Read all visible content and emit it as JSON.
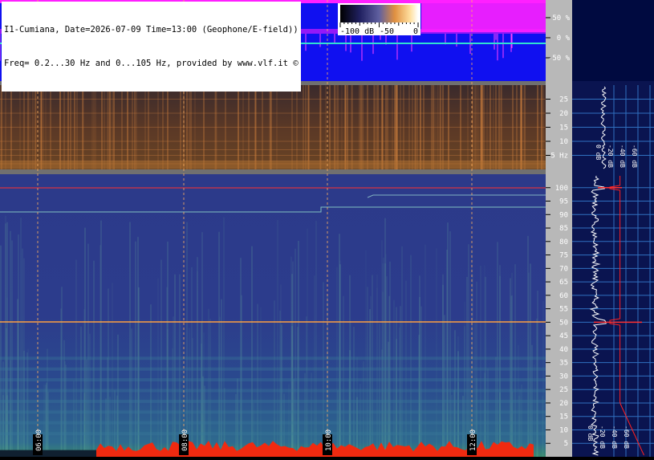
{
  "header": {
    "line1": "I1-Cumiana, Date=2026-07-09 Time=13:00 (Geophone/E-field))",
    "line2": "Freq= 0.2...30 Hz and 0...105 Hz, provided by www.vlf.it ©"
  },
  "colorbar": {
    "labels": [
      "-100 dB",
      "-50",
      "0"
    ]
  },
  "amplitude_panel": {
    "tick_labels": [
      "50 %",
      "0 %",
      "-50 %"
    ]
  },
  "low_freq_panel": {
    "tick_labels": [
      "25",
      "20",
      "15",
      "10",
      "5 Hz"
    ],
    "spectrum_ticks": [
      "0 dB",
      "-20 dB",
      "-40 dB",
      "-60 dB"
    ]
  },
  "high_freq_panel": {
    "tick_labels": [
      "100",
      "95",
      "90",
      "85",
      "80",
      "75",
      "70",
      "65",
      "60",
      "55",
      "50",
      "45",
      "40",
      "35",
      "30",
      "25",
      "20",
      "15",
      "10",
      "5"
    ],
    "spectrum_ticks": [
      "0 dB",
      "-20 dB",
      "-40 dB",
      "-60 dB"
    ]
  },
  "time_labels": [
    "06:00",
    "08:00",
    "10:00",
    "12:00"
  ],
  "colors": {
    "amplitude_bg": "#1010f0",
    "amplitude_trace": "#ff20ff",
    "zero_trace": "#30e0d0",
    "spectrogram_low": "#4a2a20",
    "spectrogram_high": "#2a3580",
    "grid_line": "#ffb060",
    "mains_line": "#ff3030",
    "axis_panel": "#b8b8b8",
    "right_panel": "#0a1450"
  },
  "chart_data": [
    {
      "type": "heatmap",
      "title": "I1-Cumiana, Date=2026-07-09 Time=13:00 (Geophone/E-field))",
      "ylabel": "Hz",
      "x_tick_labels": [
        "06:00",
        "08:00",
        "10:00",
        "12:00"
      ],
      "ylim": [
        0,
        30
      ],
      "y_ticks": [
        5,
        10,
        15,
        20,
        25
      ],
      "colorbar": {
        "min": -100,
        "max": 0,
        "unit": "dB",
        "ticks": [
          -100,
          -50,
          0
        ]
      }
    },
    {
      "type": "heatmap",
      "ylim": [
        0,
        105
      ],
      "y_ticks": [
        5,
        10,
        15,
        20,
        25,
        30,
        35,
        40,
        45,
        50,
        55,
        60,
        65,
        70,
        75,
        80,
        85,
        90,
        95,
        100
      ],
      "highlighted_lines_hz": [
        50,
        100
      ],
      "spectrum": {
        "x_ticks_db": [
          0,
          -20,
          -40,
          -60
        ],
        "peaks_hz": [
          50,
          100
        ]
      }
    }
  ]
}
